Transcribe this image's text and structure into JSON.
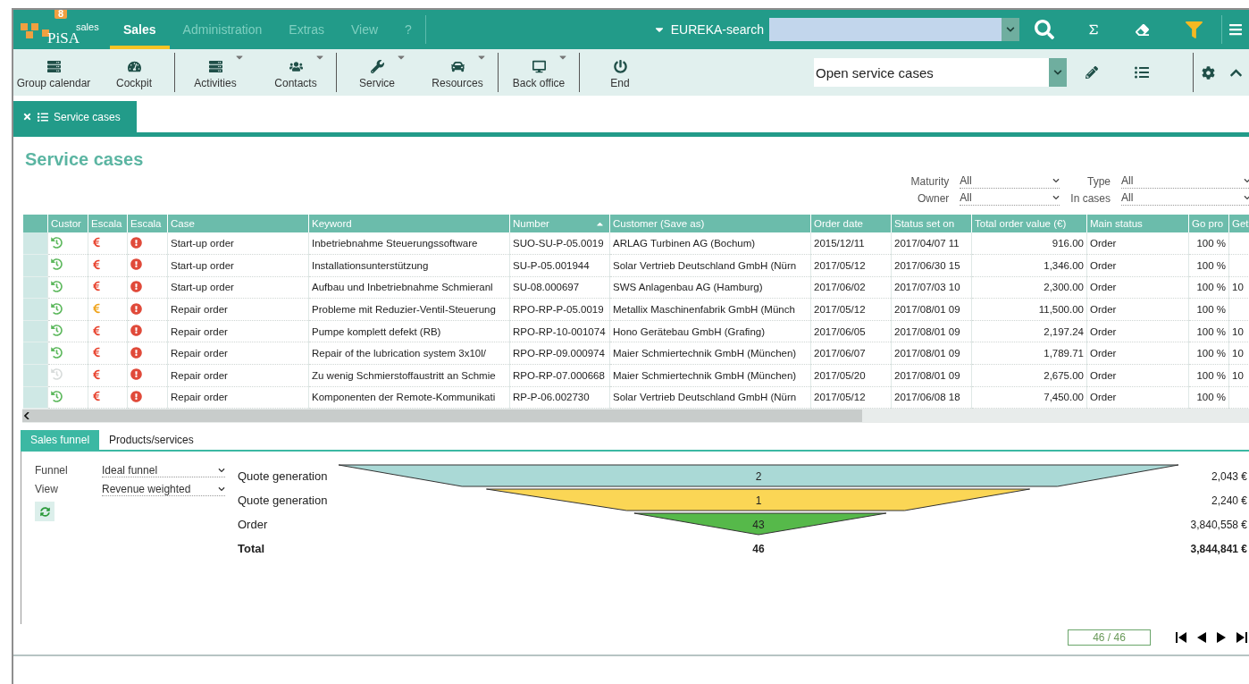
{
  "logo": {
    "badge": "8",
    "product": "sales",
    "brand": "PiSA"
  },
  "menu": [
    {
      "label": "Sales",
      "selected": true
    },
    {
      "label": "Administration",
      "selected": false
    },
    {
      "label": "Extras",
      "selected": false
    },
    {
      "label": "View",
      "selected": false
    },
    {
      "label": "?",
      "selected": false
    }
  ],
  "search": {
    "label": "EUREKA-search"
  },
  "toolbar": {
    "groups": [
      [
        {
          "label": "Group calendar",
          "has_menu": false
        },
        {
          "label": "Cockpit",
          "has_menu": false
        }
      ],
      [
        {
          "label": "Activities",
          "has_menu": true
        },
        {
          "label": "Contacts",
          "has_menu": true
        }
      ],
      [
        {
          "label": "Service",
          "has_menu": true
        },
        {
          "label": "Resources",
          "has_menu": true
        }
      ],
      [
        {
          "label": "Back office",
          "has_menu": true
        }
      ],
      [
        {
          "label": "End",
          "has_menu": false
        }
      ]
    ],
    "view_select": {
      "value": "Open service cases"
    }
  },
  "tabs": [
    {
      "label": "Service cases",
      "selected": true
    }
  ],
  "title": "Service cases",
  "filters": [
    {
      "label": "Maturity",
      "value": "All"
    },
    {
      "label": "Type",
      "value": "All"
    },
    {
      "label": "Owner",
      "value": "All"
    },
    {
      "label": "In cases",
      "value": "All"
    }
  ],
  "table": {
    "columns": [
      {
        "label": "Custor",
        "sorted": false
      },
      {
        "label": "Escala",
        "sorted": false
      },
      {
        "label": "Escala",
        "sorted": false
      },
      {
        "label": "Case",
        "sorted": false
      },
      {
        "label": "Keyword",
        "sorted": false
      },
      {
        "label": "Number",
        "sorted": true
      },
      {
        "label": "Customer (Save as)",
        "sorted": false
      },
      {
        "label": "Order date",
        "sorted": false
      },
      {
        "label": "Status set on",
        "sorted": false
      },
      {
        "label": "Total order value (€)",
        "sorted": false
      },
      {
        "label": "Main status",
        "sorted": false
      },
      {
        "label": "Go pro",
        "sorted": false
      },
      {
        "label": "Get",
        "sorted": false
      }
    ],
    "rows": [
      {
        "contact_active": true,
        "color": "#e8432e",
        "case": "Start-up order",
        "keyword": "Inbetriebnahme Steuerungssoftware",
        "number": "SUO-SU-P-05.0019",
        "customer": "ARLAG Turbinen AG (Bochum)",
        "order_date": "2015/12/11",
        "status_set_on": "2017/04/07 11",
        "total": "916.00",
        "main_status": "Order",
        "go_pro": "100 %"
      },
      {
        "contact_active": true,
        "color": "#e8432e",
        "case": "Start-up order",
        "keyword": "Installationsunterstützung",
        "number": "SU-P-05.001944",
        "customer": "Solar Vertrieb Deutschland GmbH (Nürn",
        "order_date": "2017/05/12",
        "status_set_on": "2017/06/30 15",
        "total": "1,346.00",
        "main_status": "Order",
        "go_pro": "100 %"
      },
      {
        "contact_active": true,
        "color": "#e8432e",
        "case": "Start-up order",
        "keyword": "Aufbau und Inbetriebnahme Schmieranl",
        "number": "SU-08.000697",
        "customer": "SWS Anlagenbau AG (Hamburg)",
        "order_date": "2017/06/02",
        "status_set_on": "2017/07/03 10",
        "total": "2,300.00",
        "main_status": "Order",
        "go_pro": "100 %",
        "get": "10"
      },
      {
        "contact_active": true,
        "color": "#f0a41c",
        "case": "Repair order",
        "keyword": "Probleme mit Reduzier-Ventil-Steuerung",
        "number": "RPO-RP-P-05.0019",
        "customer": "Metallix Maschinenfabrik GmbH (Münch",
        "order_date": "2017/05/12",
        "status_set_on": "2017/08/01 09",
        "total": "11,500.00",
        "main_status": "Order",
        "go_pro": "100 %"
      },
      {
        "contact_active": true,
        "color": "#e8432e",
        "case": "Repair order",
        "keyword": "Pumpe komplett defekt (RB)",
        "number": "RPO-RP-10-001074",
        "customer": "Hono Gerätebau GmbH (Grafing)",
        "order_date": "2017/06/05",
        "status_set_on": "2017/08/01 09",
        "total": "2,197.24",
        "main_status": "Order",
        "go_pro": "100 %",
        "get": "10"
      },
      {
        "contact_active": true,
        "color": "#e8432e",
        "case": "Repair order",
        "keyword": "Repair of the lubrication system 3x10l/",
        "number": "RPO-RP-09.000974",
        "customer": "Maier Schmiertechnik GmbH (München)",
        "order_date": "2017/06/07",
        "status_set_on": "2017/08/01 09",
        "total": "1,789.71",
        "main_status": "Order",
        "go_pro": "100 %",
        "get": "10"
      },
      {
        "contact_active": false,
        "color": "#e8432e",
        "case": "Repair order",
        "keyword": "Zu wenig Schmierstoffaustritt an Schmie",
        "number": "RPO-RP-07.000668",
        "customer": "Maier Schmiertechnik GmbH (München)",
        "order_date": "2017/05/20",
        "status_set_on": "2017/08/01 09",
        "total": "2,675.00",
        "main_status": "Order",
        "go_pro": "100 %",
        "get": "10"
      },
      {
        "contact_active": true,
        "color": "#e8432e",
        "case": "Repair order",
        "keyword": "Komponenten der Remote-Kommunikati",
        "number": "RP-P-06.002730",
        "customer": "Solar Vertrieb Deutschland GmbH (Nürn",
        "order_date": "2017/05/12",
        "status_set_on": "2017/06/08 18",
        "total": "7,450.00",
        "main_status": "Order",
        "go_pro": "100 %"
      }
    ]
  },
  "bottom_tabs": [
    {
      "label": "Sales funnel",
      "selected": true
    },
    {
      "label": "Products/services",
      "selected": false
    }
  ],
  "funnel": {
    "settings": [
      {
        "label": "Funnel",
        "value": "Ideal funnel"
      },
      {
        "label": "View",
        "value": "Revenue weighted"
      }
    ],
    "stages": [
      {
        "label": "Quote generation",
        "count": "2",
        "value": "2,043 €",
        "color": "#aad9d6"
      },
      {
        "label": "Quote generation",
        "count": "1",
        "value": "2,240 €",
        "color": "#fbd655"
      },
      {
        "label": "Order",
        "count": "43",
        "value": "3,840,558 €",
        "color": "#56b94a"
      }
    ],
    "total": {
      "label": "Total",
      "count": "46",
      "value": "3,844,841 €"
    }
  },
  "pager": {
    "position": "46 / 46"
  }
}
